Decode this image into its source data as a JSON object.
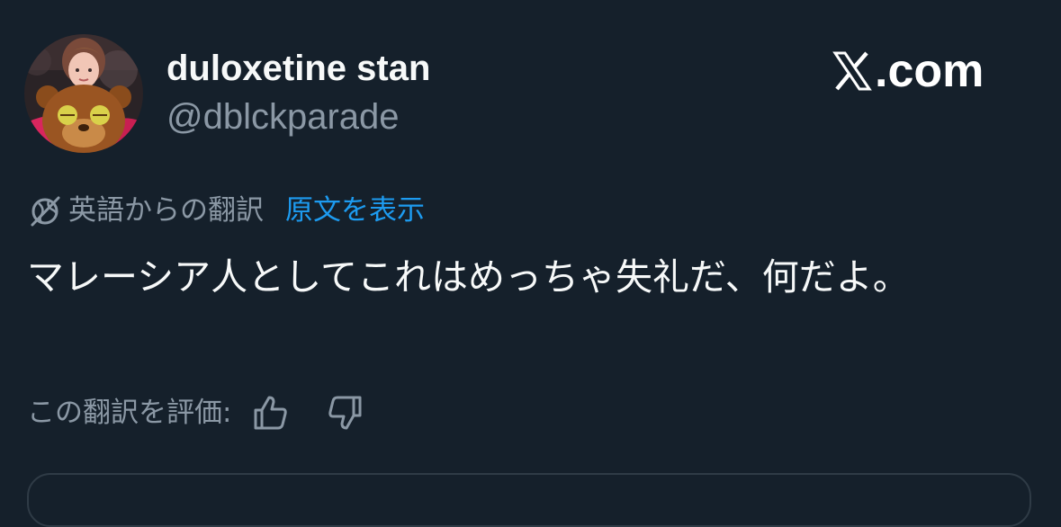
{
  "author": {
    "display_name": "duloxetine stan",
    "handle": "@dblckparade",
    "avatar": "avatar-photo-person-with-bear-costume"
  },
  "brand": {
    "logo": "x-logo-icon",
    "text": ".com"
  },
  "translation": {
    "icon": "globe-icon",
    "translated_from": "英語からの翻訳",
    "show_original": "原文を表示"
  },
  "tweet": {
    "text": "マレーシア人としてこれはめっちゃ失礼だ、何だよ。"
  },
  "rating": {
    "label": "この翻訳を評価:",
    "thumbs_up_icon": "thumbs-up-icon",
    "thumbs_down_icon": "thumbs-down-icon"
  },
  "colors": {
    "background": "#15202b",
    "primary_text": "#f7f9f9",
    "secondary_text": "#8b98a5",
    "link": "#1d9bf0"
  }
}
